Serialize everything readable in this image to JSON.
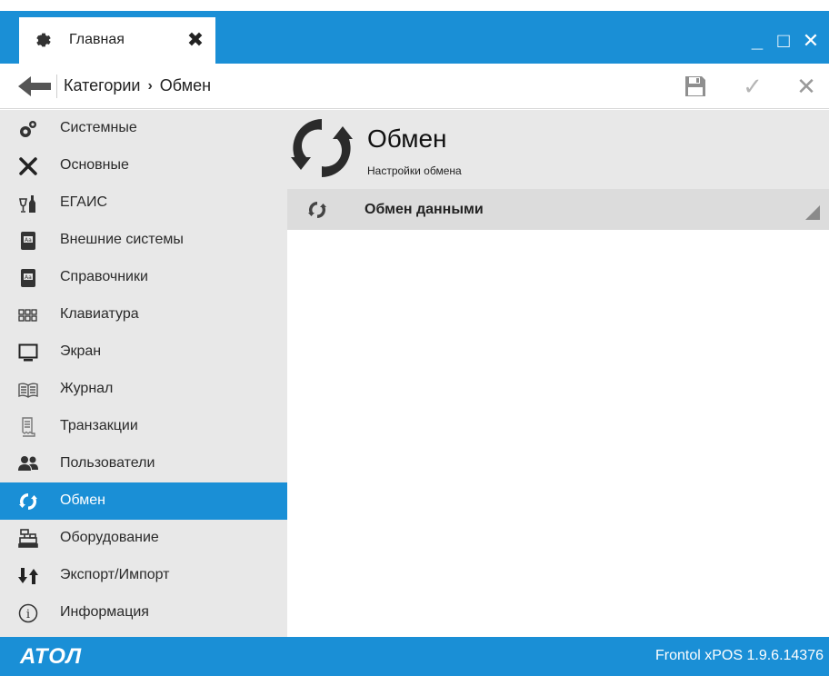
{
  "tab": {
    "label": "Главная",
    "icon": "gear-icon",
    "close": "✖"
  },
  "window": {
    "minimize": "_",
    "maximize": "□",
    "close": "✕"
  },
  "breadcrumb": {
    "root": "Категории",
    "separator": "›",
    "current": "Обмен"
  },
  "toolbar": {
    "save_icon": "save-icon",
    "ok_icon": "check-icon",
    "cancel_icon": "close-icon",
    "ok_glyph": "✓",
    "cancel_glyph": "✕"
  },
  "sidebar": {
    "items": [
      {
        "label": "Системные",
        "icon": "system-gears-icon"
      },
      {
        "label": "Основные",
        "icon": "tools-icon"
      },
      {
        "label": "ЕГАИС",
        "icon": "wine-bottle-icon"
      },
      {
        "label": "Внешние системы",
        "icon": "book-icon"
      },
      {
        "label": "Справочники",
        "icon": "book-icon"
      },
      {
        "label": "Клавиатура",
        "icon": "keyboard-icon"
      },
      {
        "label": "Экран",
        "icon": "monitor-icon"
      },
      {
        "label": "Журнал",
        "icon": "journal-icon"
      },
      {
        "label": "Транзакции",
        "icon": "receipt-icon"
      },
      {
        "label": "Пользователи",
        "icon": "users-icon"
      },
      {
        "label": "Обмен",
        "icon": "exchange-icon",
        "active": true
      },
      {
        "label": "Оборудование",
        "icon": "cash-register-icon"
      },
      {
        "label": "Экспорт/Импорт",
        "icon": "export-import-icon"
      },
      {
        "label": "Информация",
        "icon": "info-icon"
      }
    ]
  },
  "main": {
    "title": "Обмен",
    "subtitle": "Настройки обмена",
    "section_label": "Обмен данными"
  },
  "footer": {
    "logo": "АТОЛ",
    "version": "Frontol xPOS 1.9.6.14376"
  },
  "colors": {
    "accent": "#1a8fd6",
    "sidebar_bg": "#e8e8e8",
    "section_bg": "#dcdcdc"
  }
}
